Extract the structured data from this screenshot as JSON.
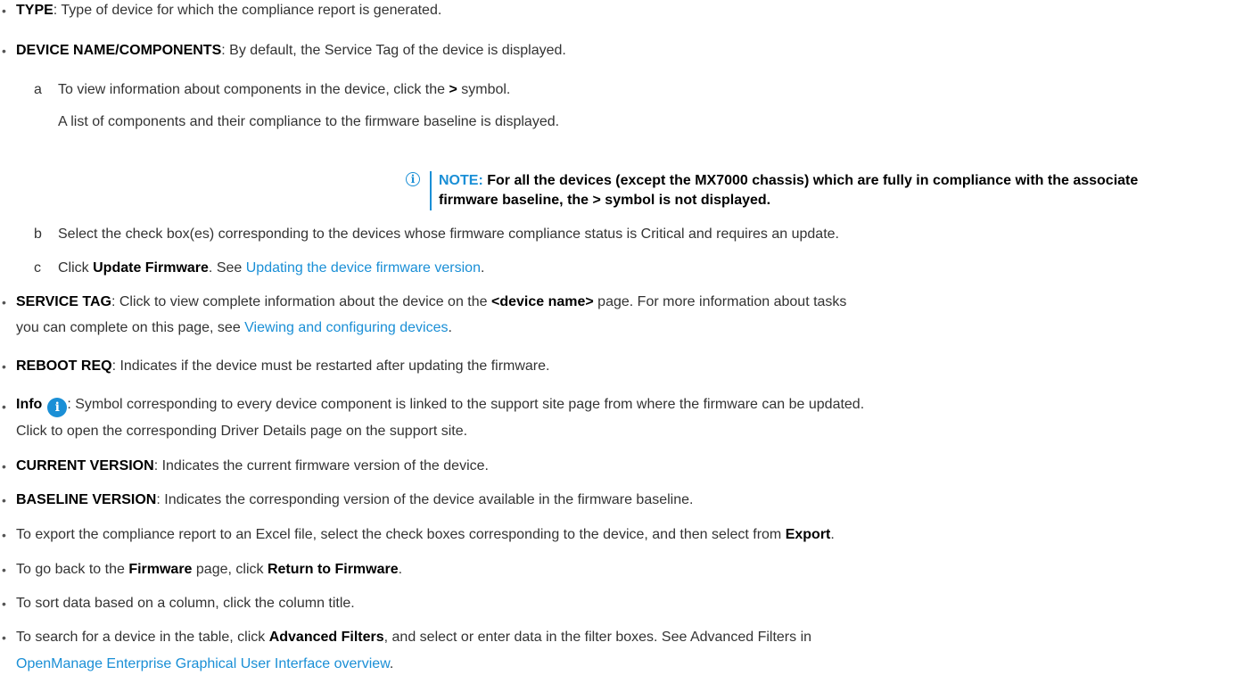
{
  "bullet": "•",
  "items": {
    "type": {
      "term": "TYPE",
      "text": ": Type of device for which the compliance report is generated."
    },
    "device_name": {
      "term": "DEVICE NAME/COMPONENTS",
      "text": ": By default, the Service Tag of the device is displayed."
    },
    "step_a": {
      "letter": "a",
      "pre": "To view information about components in the device, click the ",
      "sym": ">",
      "post": " symbol."
    },
    "step_a2": {
      "text": "A list of components and their compliance to the firmware baseline is displayed."
    },
    "note": {
      "icon": "i",
      "label": "NOTE:",
      "line1": " For all the devices (except the MX7000 chassis) which are fully in compliance with the associate",
      "line2": "firmware baseline, the > symbol is not displayed."
    },
    "step_b": {
      "letter": "b",
      "text": "Select the check box(es) corresponding to the devices whose firmware compliance status is Critical and requires an update."
    },
    "step_c": {
      "letter": "c",
      "pre": "Click ",
      "bold": "Update Firmware",
      "mid": ". See ",
      "link": "Updating the device firmware version",
      "post": "."
    },
    "service_tag": {
      "term": "SERVICE TAG",
      "pre": ": Click to view complete information about the device on the ",
      "bold": "<device name>",
      "post": " page. For more information about tasks",
      "line2_pre": "you can complete on this page, see ",
      "link": "Viewing and configuring devices",
      "line2_post": "."
    },
    "reboot": {
      "term": "REBOOT REQ",
      "text": ": Indicates if the device must be restarted after updating the firmware."
    },
    "info": {
      "term": "Info",
      "icon": "i",
      "text": ": Symbol corresponding to every device component is linked to the support site page from where the firmware can be updated.",
      "line2": "Click to open the corresponding Driver Details page on the support site."
    },
    "current": {
      "term": "CURRENT VERSION",
      "text": ": Indicates the current firmware version of the device."
    },
    "baseline": {
      "term": "BASELINE VERSION",
      "text": ": Indicates the corresponding version of the device available in the firmware baseline."
    },
    "export": {
      "pre": "To export the compliance report to an Excel file, select the check boxes corresponding to the device, and then select from ",
      "bold": "Export",
      "post": "."
    },
    "goback": {
      "pre": "To go back to the ",
      "bold1": "Firmware",
      "mid": " page, click ",
      "bold2": "Return to Firmware",
      "post": "."
    },
    "sort": {
      "text": "To sort data based on a column, click the column title."
    },
    "search": {
      "pre": "To search for a device in the table, click ",
      "bold": "Advanced Filters",
      "post": ", and select or enter data in the filter boxes. See Advanced Filters in",
      "link": "OpenManage Enterprise Graphical User Interface overview",
      "line2_post": "."
    }
  }
}
